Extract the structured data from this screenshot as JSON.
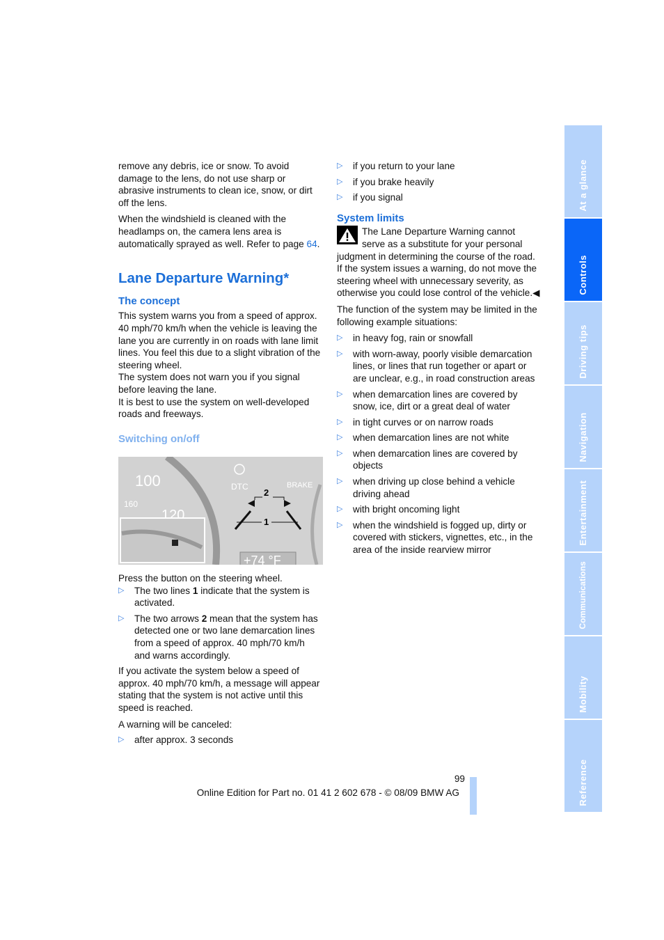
{
  "left": {
    "intro1": "remove any debris, ice or snow. To avoid damage to the lens, do not use sharp or abrasive instruments to clean ice, snow, or dirt off the lens.",
    "intro2": "When the windshield is cleaned with the headlamps on, the camera lens area is automatically sprayed as well. Refer to page ",
    "intro2_link": "64",
    "intro2_end": ".",
    "title": "Lane Departure Warning*",
    "concept_heading": "The concept",
    "concept1": "This system warns you from a speed of approx. 40 mph/70 km/h when the vehicle is leaving the lane you are currently in on roads with lane limit lines. You feel this due to a slight vibration of the steering wheel.",
    "concept2": "The system does not warn you if you signal before leaving the lane.",
    "concept3": "It is best to use the system on well-developed roads and freeways.",
    "switching_heading": "Switching on/off",
    "figure": {
      "speed_100": "100",
      "speed_160": "160",
      "speed_120": "120",
      "dtc": "DTC",
      "brake": "BRAKE",
      "label_1": "1",
      "label_2": "2",
      "temp": "+74 °F"
    },
    "press": "Press the button on the steering wheel.",
    "bullets": [
      {
        "pre": "The two lines ",
        "bold": "1",
        "post": " indicate that the system is activated."
      },
      {
        "pre": "The two arrows ",
        "bold": "2",
        "post": " mean that the system has detected one or two lane demarcation lines from a speed of approx. 40 mph/70 km/h and warns accordingly."
      }
    ],
    "below": "If you activate the system below a speed of approx. 40 mph/70 km/h, a message will appear stating that the system is not active until this speed is reached.",
    "cancel": "A warning will be canceled:",
    "cancel_bullets": [
      "after approx. 3 seconds"
    ]
  },
  "right": {
    "cancel_bullets": [
      "if you return to your lane",
      "if you brake heavily",
      "if you signal"
    ],
    "limits_heading": "System limits",
    "warning": "The Lane Departure Warning cannot serve as a substitute for your personal judgment in determining the course of the road. If the system issues a warning, do not move the steering wheel with unnecessary severity, as otherwise you could lose control of the vehicle.",
    "limited": "The function of the system may be limited in the following example situations:",
    "situations": [
      "in heavy fog, rain or snowfall",
      "with worn-away, poorly visible demarcation lines, or lines that run together or apart or are unclear, e.g., in road construction areas",
      "when demarcation lines are covered by snow, ice, dirt or a great deal of water",
      "in tight curves or on narrow roads",
      "when demarcation lines are not white",
      "when demarcation lines are covered by objects",
      "when driving up close behind a vehicle driving ahead",
      "with bright oncoming light",
      "when the windshield is fogged up, dirty or covered with stickers, vignettes, etc., in the area of the inside rearview mirror"
    ]
  },
  "footer": {
    "page": "99",
    "edition": "Online Edition for Part no. 01 41 2 602 678 - © 08/09 BMW AG"
  },
  "tabs": [
    {
      "label": "At a glance",
      "active": false
    },
    {
      "label": "Controls",
      "active": true
    },
    {
      "label": "Driving tips",
      "active": false
    },
    {
      "label": "Navigation",
      "active": false
    },
    {
      "label": "Entertainment",
      "active": false
    },
    {
      "label": "Communications",
      "active": false
    },
    {
      "label": "Mobility",
      "active": false
    },
    {
      "label": "Reference",
      "active": false
    }
  ],
  "colors": {
    "heading": "#1c6fd8",
    "tab": "#b5d3fb",
    "tab_active": "#0a66f8"
  }
}
